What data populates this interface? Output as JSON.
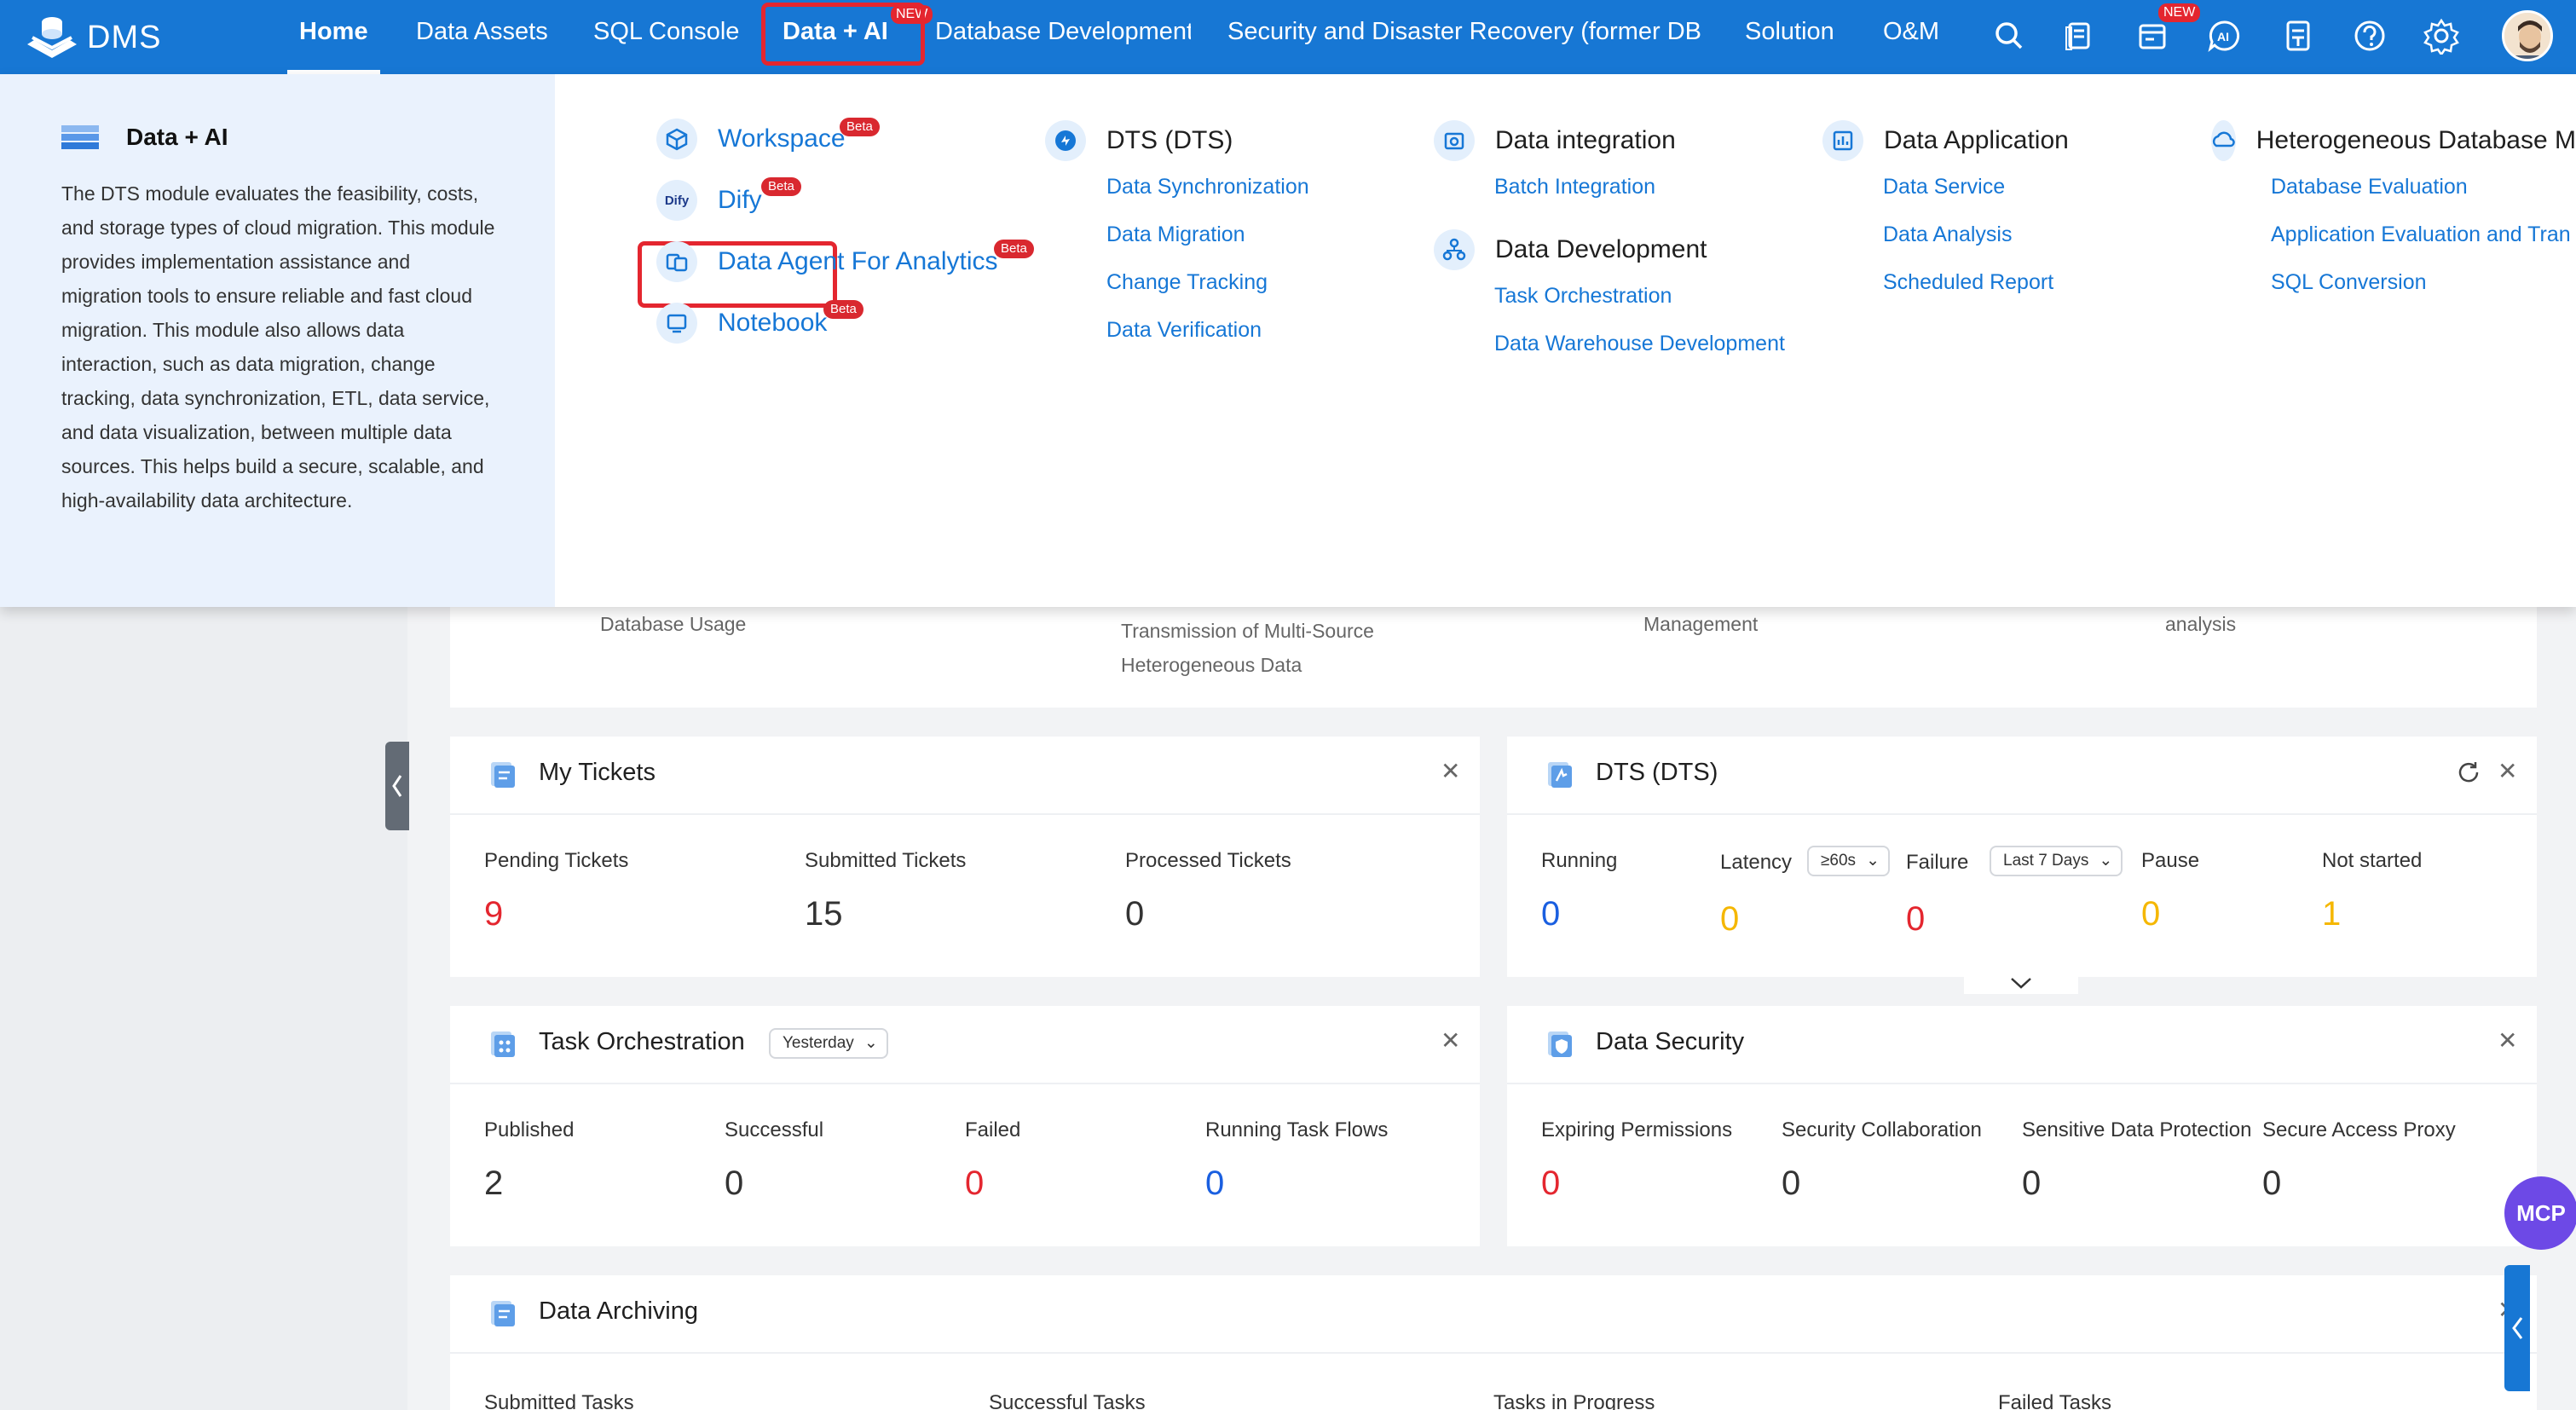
{
  "nav": {
    "logo_text": "DMS",
    "items": [
      {
        "label": "Home"
      },
      {
        "label": "Data Assets"
      },
      {
        "label": "SQL Console"
      },
      {
        "label": "Data + AI",
        "badge": "NEW"
      },
      {
        "label": "Database Development"
      },
      {
        "label": "Security and Disaster Recovery (former DB"
      },
      {
        "label": "Solution"
      },
      {
        "label": "O&M"
      }
    ],
    "right_icons": [
      "search-icon",
      "database-icon",
      "calendar-icon",
      "ai-chat-icon",
      "document-icon",
      "help-icon",
      "settings-icon"
    ],
    "calendar_badge": "NEW",
    "ai_icon_text": "AI"
  },
  "menu": {
    "section_title": "Data + AI",
    "description": "The DTS module evaluates the feasibility, costs, and storage types of cloud migration. This module provides implementation assistance and migration tools to ensure reliable and fast cloud migration. This module also allows data interaction, such as data migration, change tracking, data synchronization, ETL, data service, and data visualization, between multiple data sources. This helps build a secure, scalable, and high-availability data architecture.",
    "ai_items": [
      {
        "label": "Workspace",
        "badge": "Beta"
      },
      {
        "label": "Dify",
        "badge": "Beta",
        "icon_text": "Dify"
      },
      {
        "label": "Data Agent For Analytics",
        "badge": "Beta"
      },
      {
        "label": "Notebook",
        "badge": "Beta"
      }
    ],
    "columns": [
      {
        "title": "DTS (DTS)",
        "links": [
          "Data Synchronization",
          "Data Migration",
          "Change Tracking",
          "Data Verification"
        ]
      },
      {
        "title": "Data integration",
        "links": [
          "Batch Integration"
        ]
      },
      {
        "title": "Data Development",
        "links": [
          "Task Orchestration",
          "Data Warehouse Development"
        ]
      },
      {
        "title": "Data Application",
        "links": [
          "Data Service",
          "Data Analysis",
          "Scheduled Report"
        ]
      },
      {
        "title": "Heterogeneous Database M",
        "links": [
          "Database Evaluation",
          "Application Evaluation and Tran",
          "SQL Conversion"
        ]
      }
    ]
  },
  "banner": {
    "texts": [
      "Database Usage",
      "Transmission of Multi-Source Heterogeneous Data",
      "Management",
      "analysis"
    ]
  },
  "my_tickets": {
    "title": "My Tickets",
    "stats": [
      {
        "label": "Pending Tickets",
        "value": "9"
      },
      {
        "label": "Submitted Tickets",
        "value": "15"
      },
      {
        "label": "Processed Tickets",
        "value": "0"
      }
    ]
  },
  "dts": {
    "title": "DTS (DTS)",
    "latency_filter": "≥60s",
    "failure_filter": "Last 7 Days",
    "stats": [
      {
        "label": "Running",
        "value": "0"
      },
      {
        "label": "Latency",
        "value": "0"
      },
      {
        "label": "Failure",
        "value": "0"
      },
      {
        "label": "Pause",
        "value": "0"
      },
      {
        "label": "Not started",
        "value": "1"
      }
    ]
  },
  "task_orchestration": {
    "title": "Task Orchestration",
    "filter": "Yesterday",
    "stats": [
      {
        "label": "Published",
        "value": "2"
      },
      {
        "label": "Successful",
        "value": "0"
      },
      {
        "label": "Failed",
        "value": "0"
      },
      {
        "label": "Running Task Flows",
        "value": "0"
      }
    ]
  },
  "data_security": {
    "title": "Data Security",
    "stats": [
      {
        "label": "Expiring Permissions",
        "value": "0"
      },
      {
        "label": "Security Collaboration",
        "value": "0"
      },
      {
        "label": "Sensitive Data Protection",
        "value": "0"
      },
      {
        "label": "Secure Access Proxy",
        "value": "0"
      }
    ]
  },
  "data_archiving": {
    "title": "Data Archiving",
    "stats": [
      {
        "label": "Submitted Tasks"
      },
      {
        "label": "Successful Tasks"
      },
      {
        "label": "Tasks in Progress"
      },
      {
        "label": "Failed Tasks"
      }
    ]
  },
  "mcp_label": "MCP",
  "colors": {
    "nav_bg": "#1777d4",
    "accent_red": "#e4262f",
    "link_blue": "#1677d6",
    "warn_yellow": "#f5b700"
  }
}
